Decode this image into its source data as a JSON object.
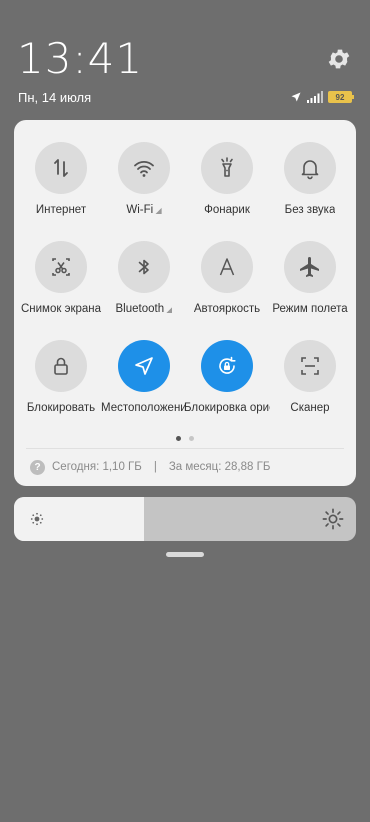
{
  "status": {
    "time": "13:41",
    "date": "Пн, 14 июля",
    "battery": "92"
  },
  "tiles": [
    {
      "label": "Интернет",
      "icon": "mobile-data-icon",
      "active": false
    },
    {
      "label": "Wi-Fi",
      "icon": "wifi-icon",
      "active": false
    },
    {
      "label": "Фонарик",
      "icon": "flashlight-icon",
      "active": false
    },
    {
      "label": "Без звука",
      "icon": "bell-icon",
      "active": false
    },
    {
      "label": "Снимок экрана",
      "icon": "screenshot-icon",
      "active": false
    },
    {
      "label": "Bluetooth",
      "icon": "bluetooth-icon",
      "active": false
    },
    {
      "label": "Автояркость",
      "icon": "auto-brightness-icon",
      "active": false
    },
    {
      "label": "Режим полета",
      "icon": "airplane-icon",
      "active": false
    },
    {
      "label": "Блокировать",
      "icon": "lock-icon",
      "active": false
    },
    {
      "label": "Местоположение",
      "icon": "location-icon",
      "active": true
    },
    {
      "label": "Блокировка ориентации",
      "icon": "rotation-lock-icon",
      "active": true
    },
    {
      "label": "Сканер",
      "icon": "scanner-icon",
      "active": false
    }
  ],
  "pager": {
    "pages": 2,
    "current": 1
  },
  "data_usage": {
    "today": "Сегодня: 1,10 ГБ",
    "separator": "|",
    "month": "За месяц: 28,88 ГБ"
  },
  "brightness": {
    "level": 0.38
  },
  "colors": {
    "accent": "#1e90e8",
    "panel": "#f2f2f2",
    "background": "#6e6e6e"
  }
}
